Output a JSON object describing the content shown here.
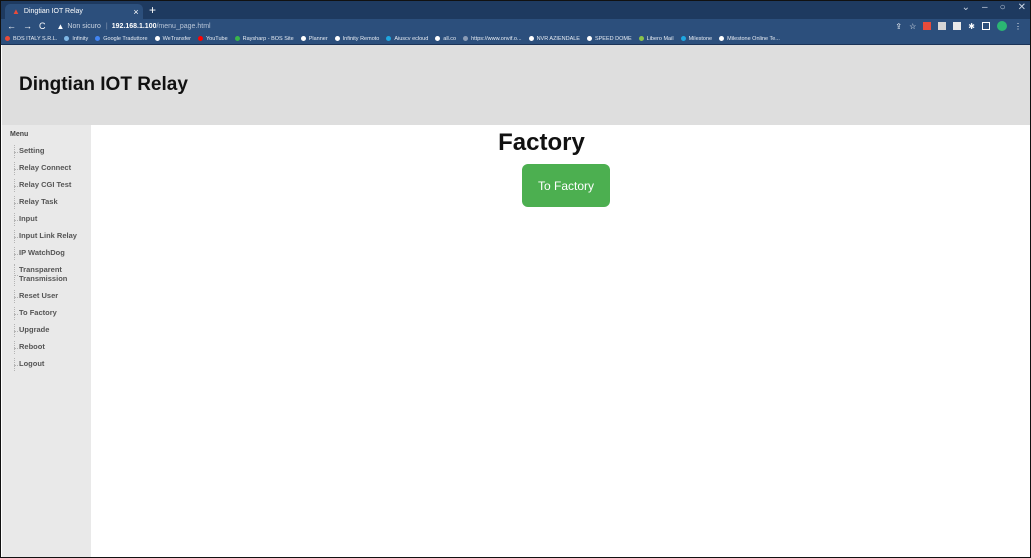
{
  "browser": {
    "tab_title": "Dingtian IOT Relay",
    "tab_close": "×",
    "new_tab": "+",
    "url_security": "Non sicuro",
    "url_host": "192.168.1.100",
    "url_path": "/menu_page.html",
    "bookmarks": [
      {
        "label": "BOS ITALY S.R.L.",
        "color": "#e84b3a"
      },
      {
        "label": "Infinity",
        "color": "#7fb8e6"
      },
      {
        "label": "Google Traduttore",
        "color": "#4285f4"
      },
      {
        "label": "WeTransfer",
        "color": "#ffffff"
      },
      {
        "label": "YouTube",
        "color": "#ff0000"
      },
      {
        "label": "Raysharp - BOS Site",
        "color": "#39b54a"
      },
      {
        "label": "Planner",
        "color": "#ffffff"
      },
      {
        "label": "Infinity Remoto",
        "color": "#ffffff"
      },
      {
        "label": "Aiuscv ecloud",
        "color": "#1ea7e1"
      },
      {
        "label": "all.co",
        "color": "#ffffff"
      },
      {
        "label": "https://www.onvif.o...",
        "color": "#8a9bb5"
      },
      {
        "label": "NVR AZIENDALE",
        "color": "#ffffff"
      },
      {
        "label": "SPEED DOME",
        "color": "#ffffff"
      },
      {
        "label": "Libero Mail",
        "color": "#8bc34a"
      },
      {
        "label": "Milestone",
        "color": "#1ea7e1"
      },
      {
        "label": "Milestone Online Te...",
        "color": "#ffffff"
      }
    ]
  },
  "header": {
    "title": "Dingtian IOT Relay"
  },
  "sidebar": {
    "menu_title": "Menu",
    "items": [
      {
        "label": "Setting"
      },
      {
        "label": "Relay Connect"
      },
      {
        "label": "Relay CGI Test"
      },
      {
        "label": "Relay Task"
      },
      {
        "label": "Input"
      },
      {
        "label": "Input Link Relay"
      },
      {
        "label": "IP WatchDog"
      },
      {
        "label": "Transparent Transmission"
      },
      {
        "label": "Reset User"
      },
      {
        "label": "To Factory"
      },
      {
        "label": "Upgrade"
      },
      {
        "label": "Reboot"
      },
      {
        "label": "Logout"
      }
    ]
  },
  "main": {
    "heading": "Factory",
    "button_label": "To Factory",
    "button_color": "#4caf50"
  }
}
